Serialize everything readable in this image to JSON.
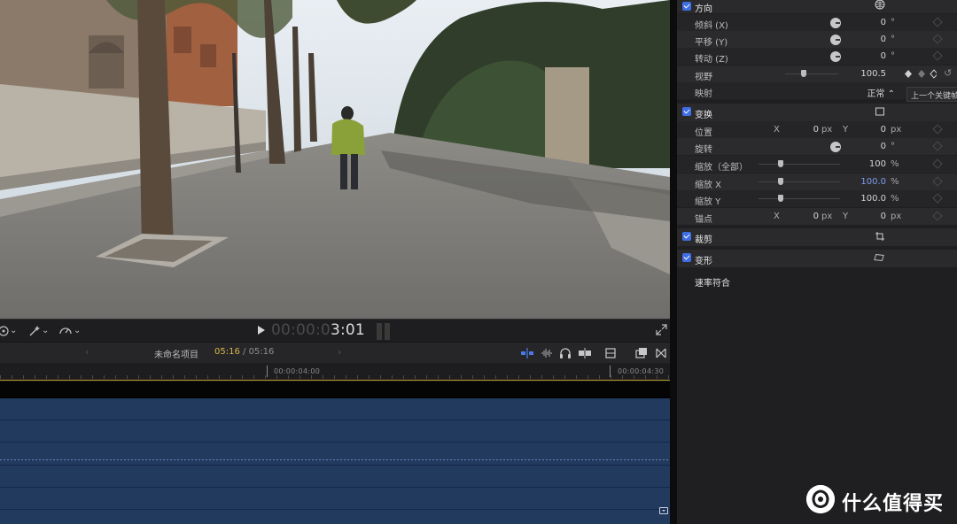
{
  "viewer": {
    "timecode_dim": "00:00:0",
    "timecode_bright": "3:01"
  },
  "timeline": {
    "project_name": "未命名项目",
    "duration_current": "05:16",
    "duration_sep": " / ",
    "duration_total": "05:16",
    "ruler_labels": [
      "00:00:04:00",
      "00:00:04:30"
    ]
  },
  "inspector": {
    "direction": {
      "title": "方向",
      "props": [
        {
          "label": "倾斜 (X)",
          "value": "0",
          "unit": "°"
        },
        {
          "label": "平移 (Y)",
          "value": "0",
          "unit": "°"
        },
        {
          "label": "转动 (Z)",
          "value": "0",
          "unit": "°"
        }
      ],
      "fov": {
        "label": "视野",
        "value": "100.5",
        "level": 0.35
      },
      "mapping": {
        "label": "映射",
        "value": "正常 ⌃",
        "tooltip": "上一个关键帧"
      }
    },
    "transform": {
      "title": "变换",
      "position": {
        "label": "位置",
        "x_axis": "X",
        "x": "0",
        "x_unit": "px",
        "y_axis": "Y",
        "y": "0",
        "y_unit": "px"
      },
      "rotation": {
        "label": "旋转",
        "value": "0",
        "unit": "°"
      },
      "scale_all": {
        "label": "缩放（全部）",
        "value": "100",
        "unit": "%",
        "level": 0.27
      },
      "scale_x": {
        "label": "缩放 X",
        "value": "100.0",
        "unit": "%",
        "level": 0.27
      },
      "scale_y": {
        "label": "缩放 Y",
        "value": "100.0",
        "unit": "%",
        "level": 0.27
      },
      "anchor": {
        "label": "锚点",
        "x_axis": "X",
        "x": "0",
        "x_unit": "px",
        "y_axis": "Y",
        "y": "0",
        "y_unit": "px"
      }
    },
    "crop": {
      "title": "裁剪"
    },
    "distort": {
      "title": "变形"
    },
    "rate_conform": {
      "label": "速率符合"
    }
  },
  "watermark": {
    "text": "什么值得买"
  },
  "colors": {
    "accent": "#3f6de4",
    "clip": "#213a5e",
    "timecode_highlight": "#d9b74a",
    "ruler_line": "#b59b2b"
  }
}
